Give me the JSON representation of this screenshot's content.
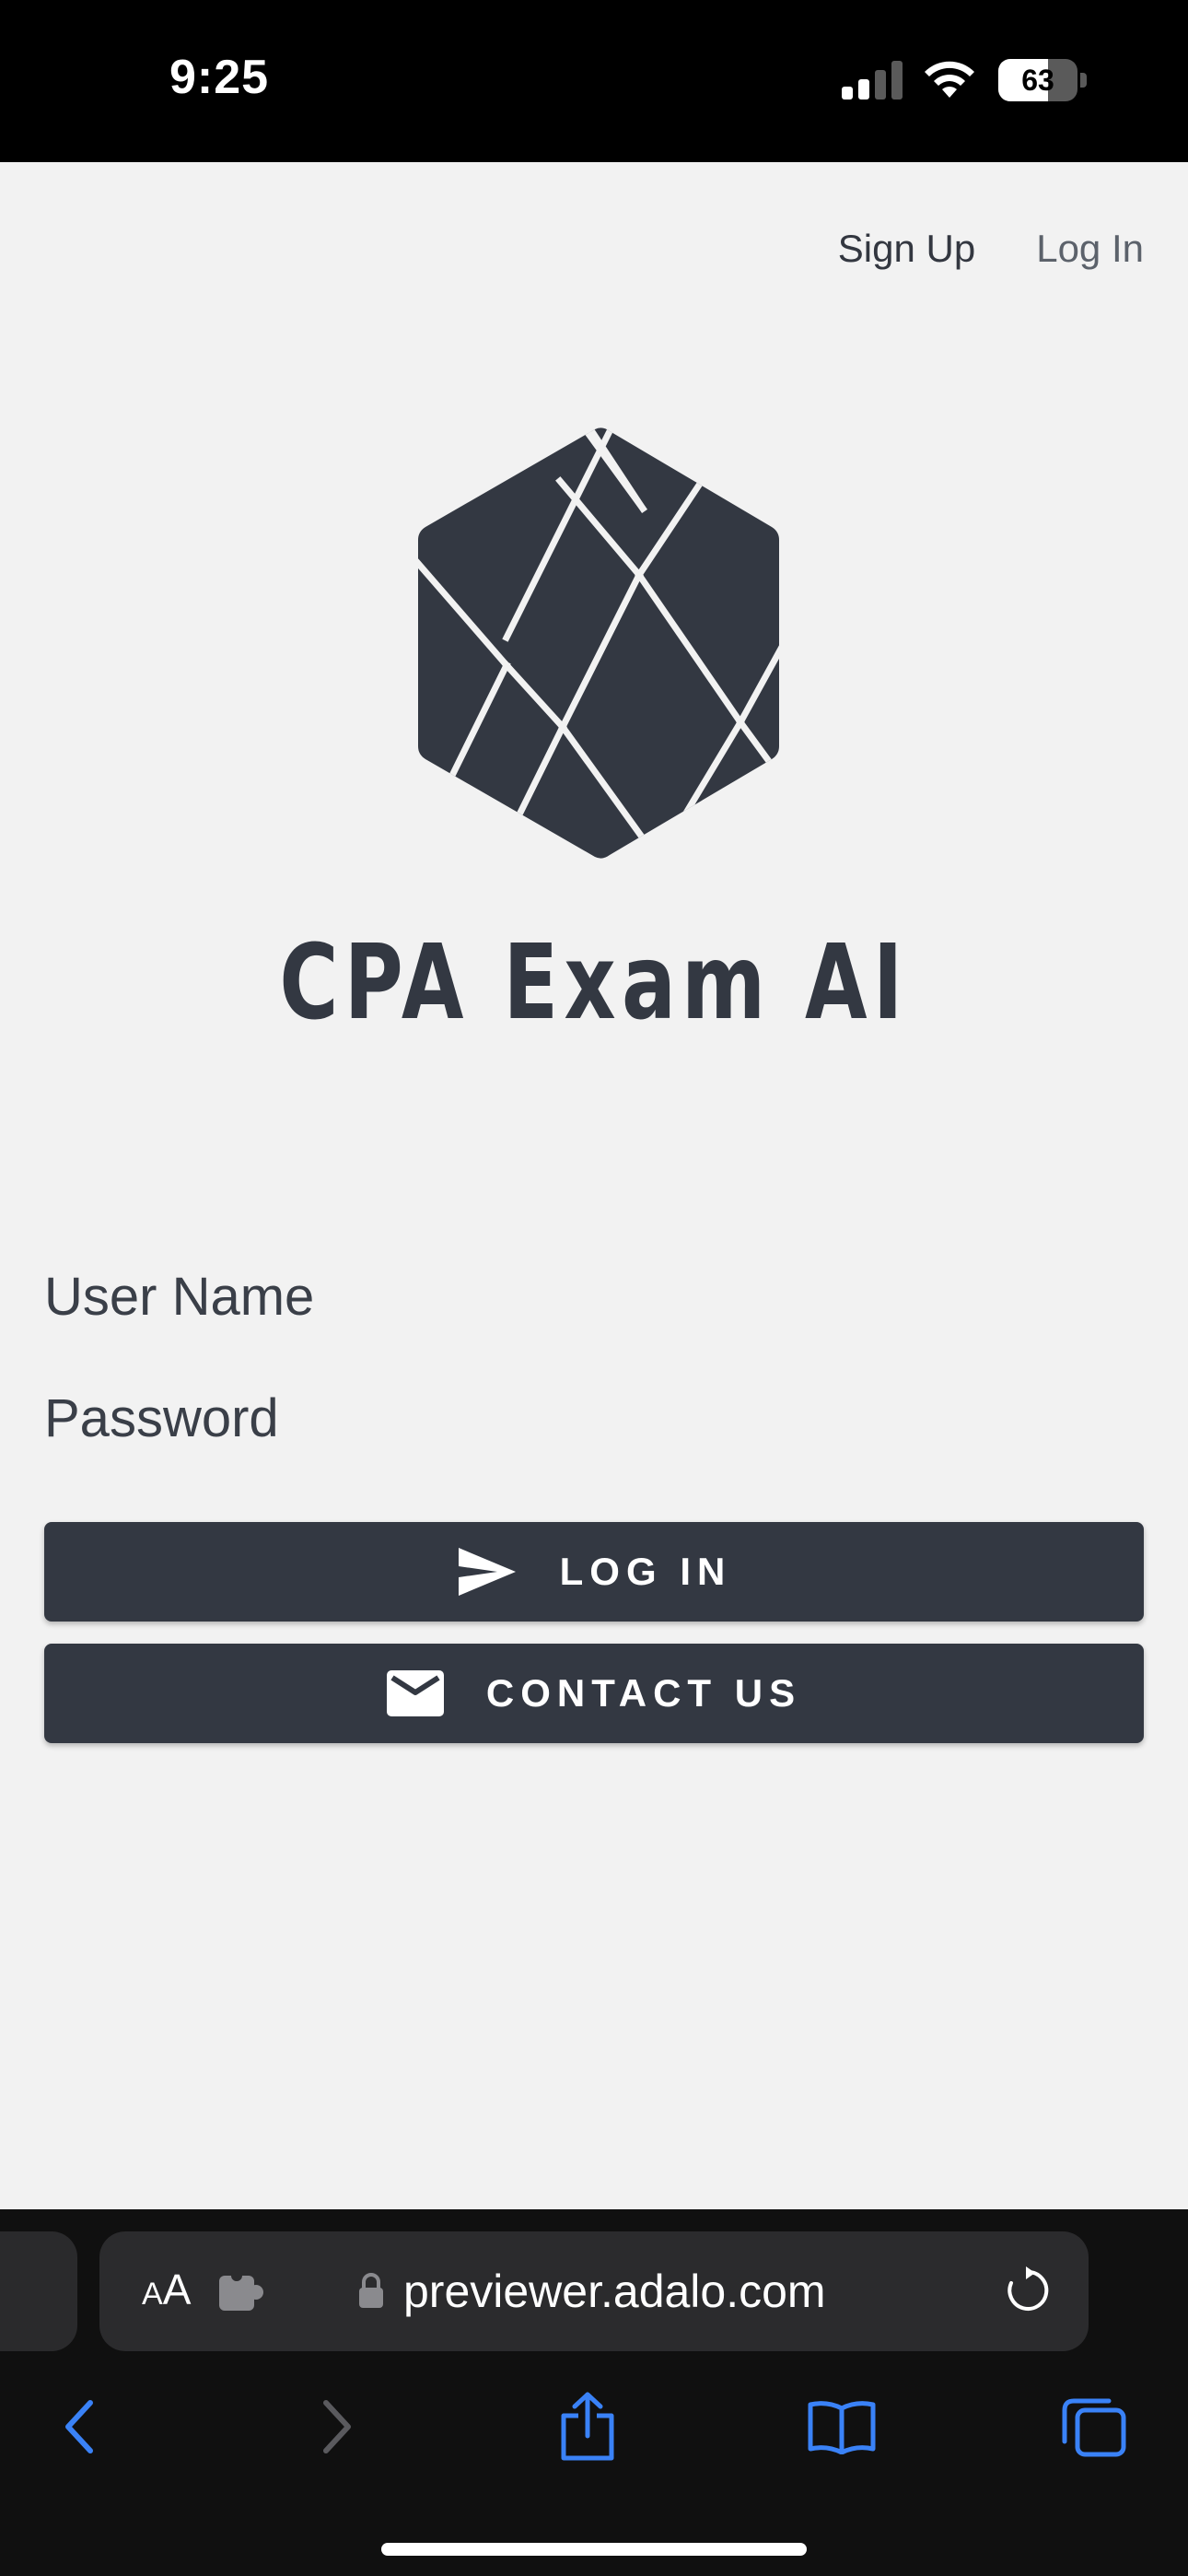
{
  "status_bar": {
    "time": "9:25",
    "battery_percent": "63",
    "battery_level": 0.63
  },
  "nav": {
    "signup_label": "Sign Up",
    "login_label": "Log In"
  },
  "app": {
    "title": "CPA Exam AI",
    "logo_icon": "hexagon-logo-icon",
    "colors": {
      "primary": "#333842",
      "background": "#f2f2f2"
    }
  },
  "form": {
    "username_label": "User Name",
    "password_label": "Password",
    "login_button": "LOG IN",
    "contact_button": "CONTACT US"
  },
  "browser": {
    "text_size_label_small": "A",
    "text_size_label_large": "A",
    "url": "previewer.adalo.com",
    "accent": "#3a82f7"
  }
}
